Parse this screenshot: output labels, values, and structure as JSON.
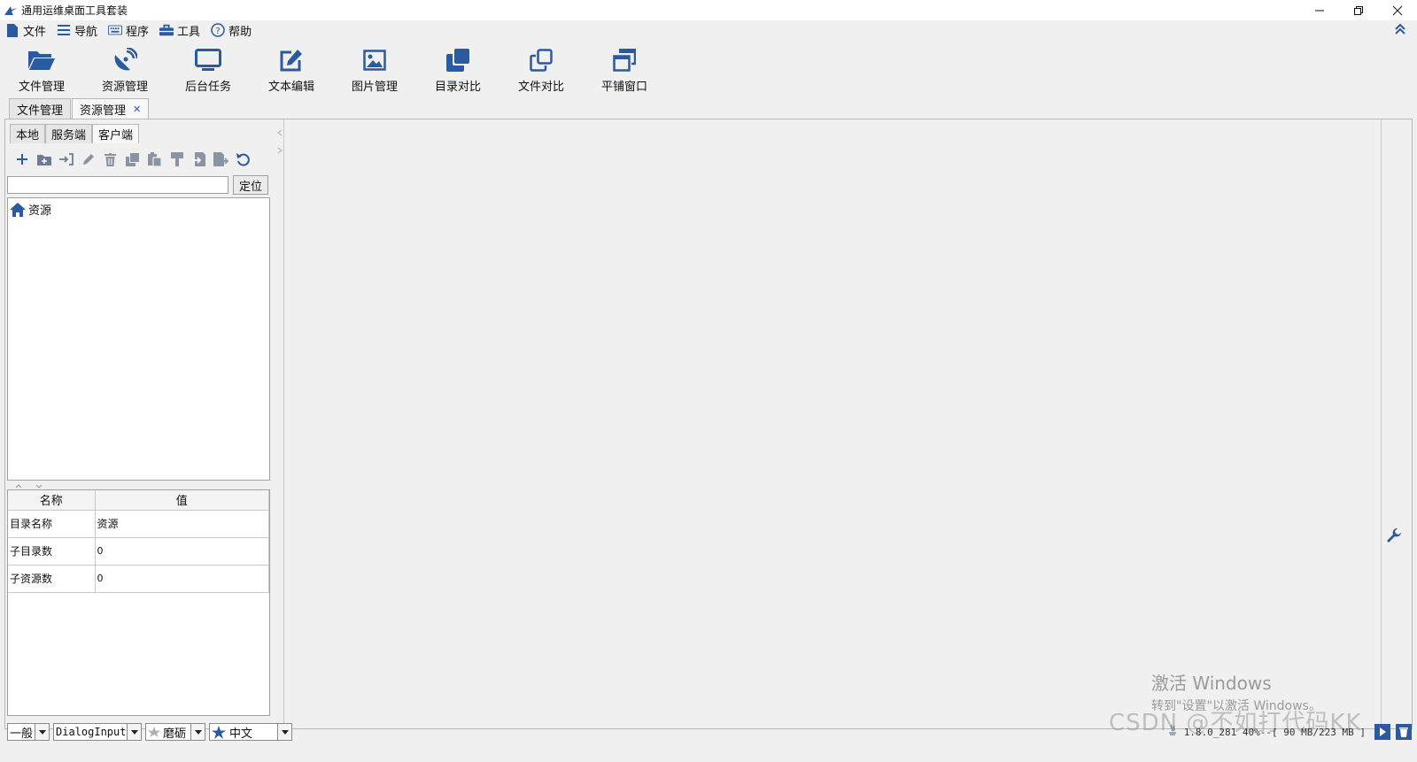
{
  "window": {
    "title": "通用运维桌面工具套装",
    "controls": [
      "minimize-icon",
      "restore-icon",
      "close-icon"
    ]
  },
  "menubar": {
    "items": [
      {
        "label": "文件",
        "icon": "file-icon"
      },
      {
        "label": "导航",
        "icon": "list-icon"
      },
      {
        "label": "程序",
        "icon": "keyboard-icon"
      },
      {
        "label": "工具",
        "icon": "toolbox-icon"
      },
      {
        "label": "帮助",
        "icon": "help-icon"
      }
    ]
  },
  "toolbar": {
    "items": [
      {
        "label": "文件管理",
        "icon": "folder-open-icon"
      },
      {
        "label": "资源管理",
        "icon": "satellite-dish-icon"
      },
      {
        "label": "后台任务",
        "icon": "monitor-icon"
      },
      {
        "label": "文本编辑",
        "icon": "edit-icon"
      },
      {
        "label": "图片管理",
        "icon": "image-icon"
      },
      {
        "label": "目录对比",
        "icon": "clone-solid-icon"
      },
      {
        "label": "文件对比",
        "icon": "clone-outline-icon"
      },
      {
        "label": "平铺窗口",
        "icon": "window-restore-icon"
      }
    ]
  },
  "doc_tabs": [
    {
      "label": "文件管理",
      "active": false,
      "closable": false
    },
    {
      "label": "资源管理",
      "active": true,
      "closable": true,
      "close_glyph": "✕"
    }
  ],
  "left_panel": {
    "sub_tabs": [
      {
        "label": "本地",
        "active": false
      },
      {
        "label": "服务端",
        "active": false
      },
      {
        "label": "客户端",
        "active": true
      }
    ],
    "action_icons": [
      "add-icon",
      "new-folder-icon",
      "import-icon",
      "rename-icon",
      "delete-icon",
      "copy-icon",
      "paste-icon",
      "format-painter-icon",
      "move-in-icon",
      "export-icon",
      "refresh-icon"
    ],
    "search": {
      "value": "",
      "placeholder": "",
      "button": "定位"
    },
    "tree": {
      "root": {
        "label": "资源",
        "icon": "home-icon"
      }
    },
    "props": {
      "headers": [
        "名称",
        "值"
      ],
      "rows": [
        {
          "name": "目录名称",
          "value": "资源"
        },
        {
          "name": "子目录数",
          "value": "0"
        },
        {
          "name": "子资源数",
          "value": "0"
        }
      ]
    }
  },
  "statusbar": {
    "combos": [
      {
        "value": "一般"
      },
      {
        "value": "DialogInput"
      },
      {
        "value": "磨砺",
        "icon": "leaf-icon"
      },
      {
        "value": "中文",
        "icon": "star-icon"
      }
    ],
    "memory": "1.8.0_281 40%--[ 90 MB/223 MB ]"
  },
  "watermark": {
    "line1": "激活 Windows",
    "line2": "转到\"设置\"以激活 Windows。",
    "csdn": "CSDN @不如打代码KK"
  },
  "colors": {
    "accent": "#2b5aa0",
    "background": "#f0f0f0",
    "border": "#b8b8b8"
  }
}
